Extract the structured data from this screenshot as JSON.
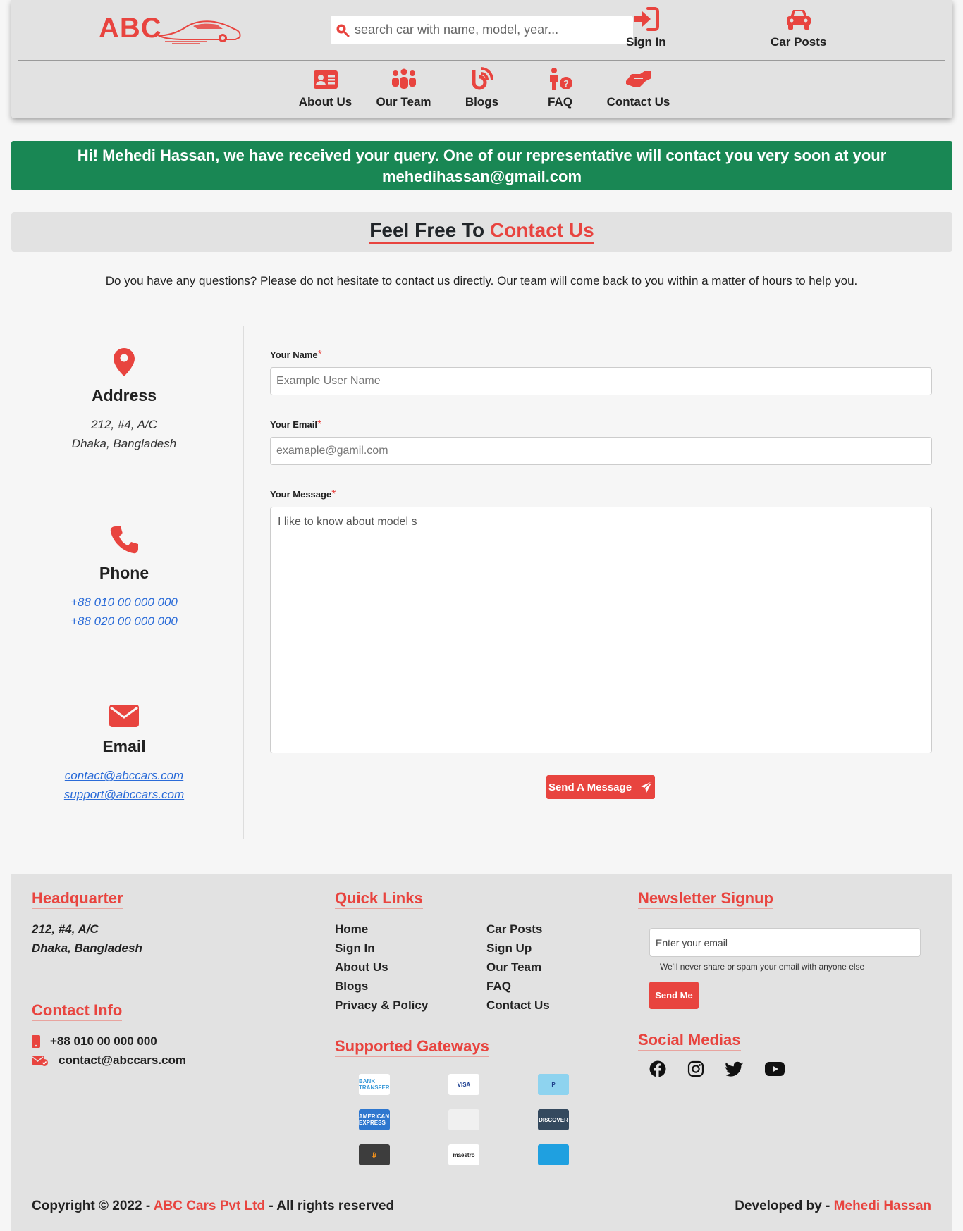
{
  "header": {
    "logo_text": "ABC",
    "search_placeholder": "search car with name, model, year...",
    "sign_in": "Sign In",
    "car_posts": "Car Posts",
    "nav": [
      {
        "label": "About Us"
      },
      {
        "label": "Our Team"
      },
      {
        "label": "Blogs"
      },
      {
        "label": "FAQ"
      },
      {
        "label": "Contact Us"
      }
    ]
  },
  "alert": {
    "message": "Hi! Mehedi Hassan, we have received your query. One of our representative will contact you very soon at your mehedihassan@gmail.com"
  },
  "page": {
    "title_prefix": "Feel Free To",
    "title_accent": "Contact Us",
    "intro": "Do you have any questions? Please do not hesitate to contact us directly. Our team will come back to you within a matter of hours to help you."
  },
  "info": {
    "address": {
      "title": "Address",
      "line1": "212, #4, A/C",
      "line2": "Dhaka, Bangladesh"
    },
    "phone": {
      "title": "Phone",
      "line1": "+88 010 00 000 000",
      "line2": "+88 020 00 000 000"
    },
    "email": {
      "title": "Email",
      "line1": "contact@abccars.com",
      "line2": "support@abccars.com"
    }
  },
  "form": {
    "name_label": "Your Name",
    "name_placeholder": "Example User Name",
    "email_label": "Your Email",
    "email_placeholder": "examaple@gamil.com",
    "message_label": "Your Message",
    "message_value": "I like to know about model s",
    "required_mark": "*",
    "submit": "Send A Message"
  },
  "footer": {
    "headquarter": {
      "title": "Headquarter",
      "line1": "212, #4, A/C",
      "line2": "Dhaka, Bangladesh"
    },
    "contact_info": {
      "title": "Contact Info",
      "phone": "+88 010 00 000 000",
      "email": "contact@abccars.com"
    },
    "quick_links": {
      "title": "Quick Links",
      "col1": [
        "Home",
        "Sign In",
        "About Us",
        "Blogs",
        "Privacy & Policy"
      ],
      "col2": [
        "Car Posts",
        "Sign Up",
        "Our Team",
        "FAQ",
        "Contact Us"
      ]
    },
    "gateways": {
      "title": "Supported Gateways",
      "items": [
        {
          "name": "bank-transfer",
          "text": "BANK TRANSFER",
          "bg": "#ffffff",
          "fg": "#3a9ad9"
        },
        {
          "name": "visa",
          "text": "VISA",
          "bg": "#ffffff",
          "fg": "#1a3d8f"
        },
        {
          "name": "paypal",
          "text": "P",
          "bg": "#8ed3ef",
          "fg": "#1f3f8a"
        },
        {
          "name": "american-express",
          "text": "AMERICAN EXPRESS",
          "bg": "#2e77cf",
          "fg": "#ffffff"
        },
        {
          "name": "card",
          "text": "",
          "bg": "#f0f0f0",
          "fg": "#2c3e50"
        },
        {
          "name": "discover",
          "text": "DISCOVER",
          "bg": "#34495e",
          "fg": "#ffffff"
        },
        {
          "name": "bitcoin",
          "text": "₿",
          "bg": "#3d3d3d",
          "fg": "#f7931a"
        },
        {
          "name": "maestro",
          "text": "maestro",
          "bg": "#ffffff",
          "fg": "#222222"
        },
        {
          "name": "mastercard",
          "text": "",
          "bg": "#1fa0e0",
          "fg": "#ffffff"
        }
      ]
    },
    "newsletter": {
      "title": "Newsletter Signup",
      "placeholder": "Enter your email",
      "note": "We'll never share or spam your email with anyone else",
      "button": "Send Me"
    },
    "social": {
      "title": "Social Medias",
      "icons": [
        "facebook-icon",
        "instagram-icon",
        "twitter-icon",
        "youtube-icon"
      ]
    },
    "copyright_prefix": "Copyright © 2022 -",
    "copyright_company": "ABC Cars Pvt Ltd",
    "copyright_suffix": "- All rights reserved",
    "developed_prefix": "Developed by -",
    "developer": "Mehedi Hassan"
  },
  "colors": {
    "accent": "#e8443f",
    "success": "#198754",
    "panel": "#e2e2e2"
  }
}
